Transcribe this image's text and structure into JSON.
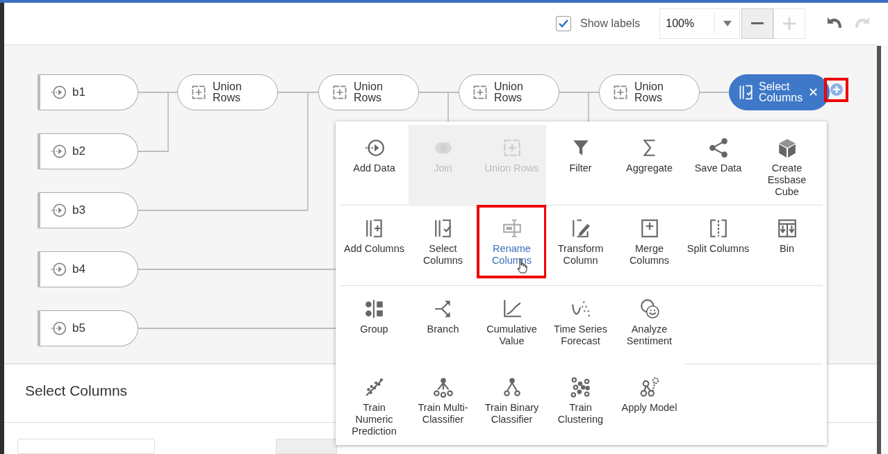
{
  "toolbar": {
    "show_labels": {
      "label": "Show labels",
      "checked": true
    },
    "zoom": {
      "value": "100%"
    },
    "zoom_out": {
      "disabled": false
    },
    "zoom_in": {
      "disabled": true
    },
    "undo": {
      "disabled": false
    },
    "redo": {
      "disabled": true
    }
  },
  "nodes": [
    {
      "kind": "source",
      "label": "b1",
      "selected": false
    },
    {
      "kind": "source",
      "label": "b2",
      "selected": false
    },
    {
      "kind": "source",
      "label": "b3",
      "selected": false
    },
    {
      "kind": "source",
      "label": "b4",
      "selected": false
    },
    {
      "kind": "source",
      "label": "b5",
      "selected": false
    },
    {
      "kind": "union",
      "label": "Union\nRows",
      "selected": false
    },
    {
      "kind": "union",
      "label": "Union\nRows",
      "selected": false
    },
    {
      "kind": "union",
      "label": "Union\nRows",
      "selected": false
    },
    {
      "kind": "union",
      "label": "Union\nRows",
      "selected": false
    },
    {
      "kind": "select",
      "label": "Select\nColumns",
      "selected": true,
      "close": "✕"
    }
  ],
  "add_step_menu": {
    "sections": [
      {
        "items": [
          {
            "label": "Add Data",
            "disabled": false,
            "selected": false
          },
          {
            "label": "Join",
            "disabled": true,
            "selected": false
          },
          {
            "label": "Union Rows",
            "disabled": true,
            "selected": false
          },
          {
            "label": "Filter",
            "disabled": false,
            "selected": false
          },
          {
            "label": "Aggregate",
            "disabled": false,
            "selected": false
          },
          {
            "label": "Save Data",
            "disabled": false,
            "selected": false
          },
          {
            "label": "Create\nEssbase\nCube",
            "disabled": false,
            "selected": false
          }
        ]
      },
      {
        "items": [
          {
            "label": "Add Columns",
            "disabled": false,
            "selected": false
          },
          {
            "label": "Select\nColumns",
            "disabled": false,
            "selected": false
          },
          {
            "label": "Rename\nColumns",
            "disabled": false,
            "selected": true
          },
          {
            "label": "Transform\nColumn",
            "disabled": false,
            "selected": false
          },
          {
            "label": "Merge\nColumns",
            "disabled": false,
            "selected": false
          },
          {
            "label": "Split Columns",
            "disabled": false,
            "selected": false
          },
          {
            "label": "Bin",
            "disabled": false,
            "selected": false
          }
        ]
      },
      {
        "items": [
          {
            "label": "Group",
            "disabled": false,
            "selected": false
          },
          {
            "label": "Branch",
            "disabled": false,
            "selected": false
          },
          {
            "label": "Cumulative\nValue",
            "disabled": false,
            "selected": false
          },
          {
            "label": "Time Series\nForecast",
            "disabled": false,
            "selected": false
          },
          {
            "label": "Analyze\nSentiment",
            "disabled": false,
            "selected": false
          }
        ]
      },
      {
        "items": [
          {
            "label": "Train\nNumeric\nPrediction",
            "disabled": false,
            "selected": false
          },
          {
            "label": "Train Multi-\nClassifier",
            "disabled": false,
            "selected": false
          },
          {
            "label": "Train Binary\nClassifier",
            "disabled": false,
            "selected": false
          },
          {
            "label": "Train\nClustering",
            "disabled": false,
            "selected": false
          },
          {
            "label": "Apply Model",
            "disabled": false,
            "selected": false
          }
        ]
      }
    ]
  },
  "details_panel": {
    "title": "Select Columns"
  }
}
